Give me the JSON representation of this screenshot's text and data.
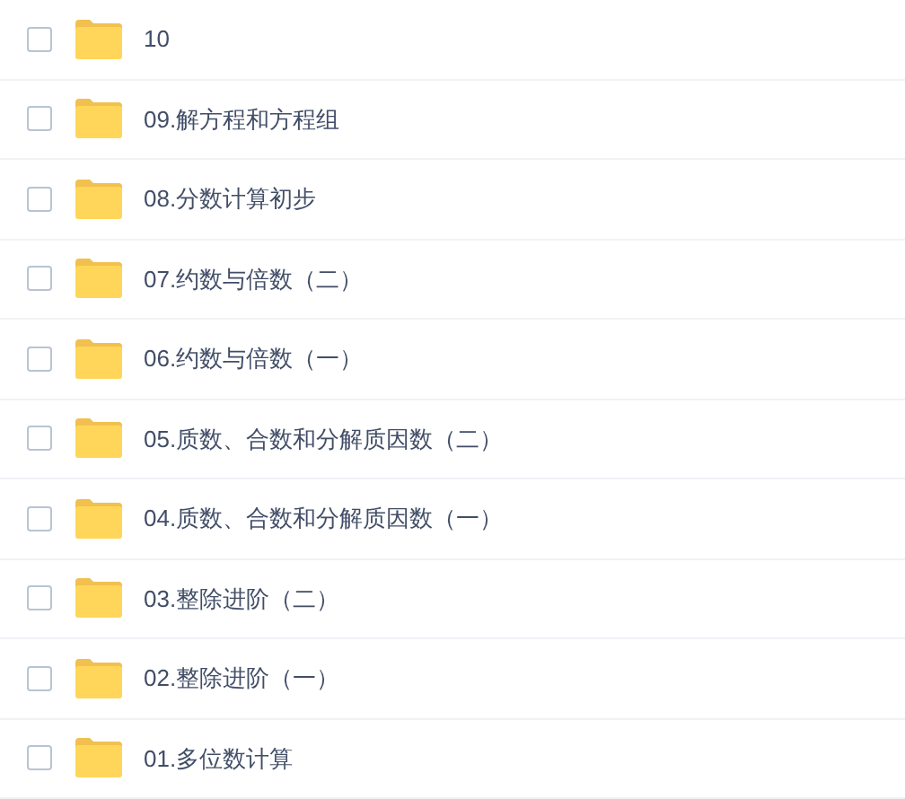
{
  "files": [
    {
      "name": "10",
      "checked": false
    },
    {
      "name": "09.解方程和方程组",
      "checked": false
    },
    {
      "name": "08.分数计算初步",
      "checked": false
    },
    {
      "name": "07.约数与倍数（二）",
      "checked": false
    },
    {
      "name": "06.约数与倍数（一）",
      "checked": false
    },
    {
      "name": "05.质数、合数和分解质因数（二）",
      "checked": false
    },
    {
      "name": "04.质数、合数和分解质因数（一）",
      "checked": false
    },
    {
      "name": "03.整除进阶（二）",
      "checked": false
    },
    {
      "name": "02.整除进阶（一）",
      "checked": false
    },
    {
      "name": "01.多位数计算",
      "checked": false
    }
  ]
}
